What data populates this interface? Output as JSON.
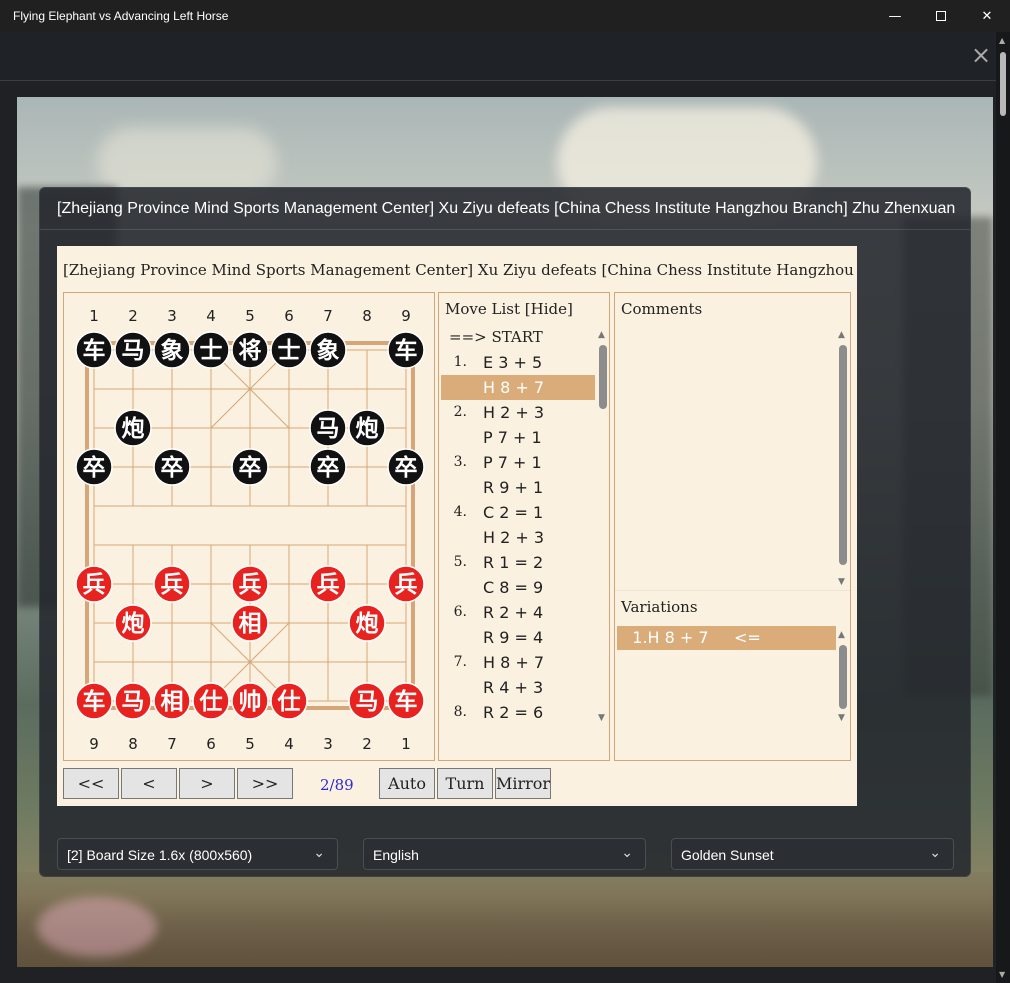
{
  "window": {
    "title": "Flying Elephant vs Advancing Left Horse"
  },
  "dialog": {
    "title": "[Zhejiang Province Mind Sports Management Center] Xu Ziyu defeats [China Chess Institute Hangzhou Branch] Zhu Zhenxuan"
  },
  "panel": {
    "title": "[Zhejiang Province Mind Sports Management Center] Xu Ziyu defeats [China Chess Institute Hangzhou Branch] Zhu Zhenxuan"
  },
  "board": {
    "top_files": [
      "1",
      "2",
      "3",
      "4",
      "5",
      "6",
      "7",
      "8",
      "9"
    ],
    "bottom_files": [
      "9",
      "8",
      "7",
      "6",
      "5",
      "4",
      "3",
      "2",
      "1"
    ],
    "pieces": [
      {
        "c": 0,
        "r": 0,
        "ch": "车",
        "side": "black"
      },
      {
        "c": 1,
        "r": 0,
        "ch": "马",
        "side": "black"
      },
      {
        "c": 2,
        "r": 0,
        "ch": "象",
        "side": "black"
      },
      {
        "c": 3,
        "r": 0,
        "ch": "士",
        "side": "black"
      },
      {
        "c": 4,
        "r": 0,
        "ch": "将",
        "side": "black"
      },
      {
        "c": 5,
        "r": 0,
        "ch": "士",
        "side": "black"
      },
      {
        "c": 6,
        "r": 0,
        "ch": "象",
        "side": "black"
      },
      {
        "c": 8,
        "r": 0,
        "ch": "车",
        "side": "black"
      },
      {
        "c": 1,
        "r": 2,
        "ch": "炮",
        "side": "black"
      },
      {
        "c": 6,
        "r": 2,
        "ch": "马",
        "side": "black"
      },
      {
        "c": 7,
        "r": 2,
        "ch": "炮",
        "side": "black"
      },
      {
        "c": 0,
        "r": 3,
        "ch": "卒",
        "side": "black"
      },
      {
        "c": 2,
        "r": 3,
        "ch": "卒",
        "side": "black"
      },
      {
        "c": 4,
        "r": 3,
        "ch": "卒",
        "side": "black"
      },
      {
        "c": 6,
        "r": 3,
        "ch": "卒",
        "side": "black"
      },
      {
        "c": 8,
        "r": 3,
        "ch": "卒",
        "side": "black"
      },
      {
        "c": 0,
        "r": 6,
        "ch": "兵",
        "side": "red"
      },
      {
        "c": 2,
        "r": 6,
        "ch": "兵",
        "side": "red"
      },
      {
        "c": 4,
        "r": 6,
        "ch": "兵",
        "side": "red"
      },
      {
        "c": 6,
        "r": 6,
        "ch": "兵",
        "side": "red"
      },
      {
        "c": 8,
        "r": 6,
        "ch": "兵",
        "side": "red"
      },
      {
        "c": 1,
        "r": 7,
        "ch": "炮",
        "side": "red"
      },
      {
        "c": 4,
        "r": 7,
        "ch": "相",
        "side": "red"
      },
      {
        "c": 7,
        "r": 7,
        "ch": "炮",
        "side": "red"
      },
      {
        "c": 0,
        "r": 9,
        "ch": "车",
        "side": "red"
      },
      {
        "c": 1,
        "r": 9,
        "ch": "马",
        "side": "red"
      },
      {
        "c": 2,
        "r": 9,
        "ch": "相",
        "side": "red"
      },
      {
        "c": 3,
        "r": 9,
        "ch": "仕",
        "side": "red"
      },
      {
        "c": 4,
        "r": 9,
        "ch": "帅",
        "side": "red"
      },
      {
        "c": 5,
        "r": 9,
        "ch": "仕",
        "side": "red"
      },
      {
        "c": 7,
        "r": 9,
        "ch": "马",
        "side": "red"
      },
      {
        "c": 8,
        "r": 9,
        "ch": "车",
        "side": "red"
      }
    ]
  },
  "moves": {
    "header": "Move List [Hide]",
    "start": "==> START",
    "rows": [
      {
        "num": "1.",
        "mv": "E 3 + 5"
      },
      {
        "num": "",
        "mv": "H 8 + 7",
        "selected": true
      },
      {
        "num": "2.",
        "mv": "H 2 + 3"
      },
      {
        "num": "",
        "mv": "P 7 + 1"
      },
      {
        "num": "3.",
        "mv": "P 7 + 1"
      },
      {
        "num": "",
        "mv": "R 9 + 1"
      },
      {
        "num": "4.",
        "mv": "C 2 = 1"
      },
      {
        "num": "",
        "mv": "H 2 + 3"
      },
      {
        "num": "5.",
        "mv": "R 1 = 2"
      },
      {
        "num": "",
        "mv": "C 8 = 9"
      },
      {
        "num": "6.",
        "mv": "R 2 + 4"
      },
      {
        "num": "",
        "mv": "R 9 = 4"
      },
      {
        "num": "7.",
        "mv": "H 8 + 7"
      },
      {
        "num": "",
        "mv": "R 4 + 3"
      },
      {
        "num": "8.",
        "mv": "R 2 = 6"
      }
    ]
  },
  "comments": {
    "header": "Comments"
  },
  "variations": {
    "header": "Variations",
    "row": "   1.H 8 + 7     <="
  },
  "nav": {
    "first": "<<",
    "prev": "<",
    "next": ">",
    "last": ">>",
    "counter": "2/89",
    "auto": "Auto",
    "turn": "Turn",
    "mirror": "Mirror"
  },
  "dropdowns": {
    "size": "[2] Board Size 1.6x (800x560)",
    "language": "English",
    "theme": "Golden Sunset"
  },
  "colors": {
    "red_piece": "#e8231f",
    "black_piece": "#111111",
    "board_line": "#d4a679",
    "selection": "#d9ac7a",
    "counter": "#2b2bd0"
  }
}
